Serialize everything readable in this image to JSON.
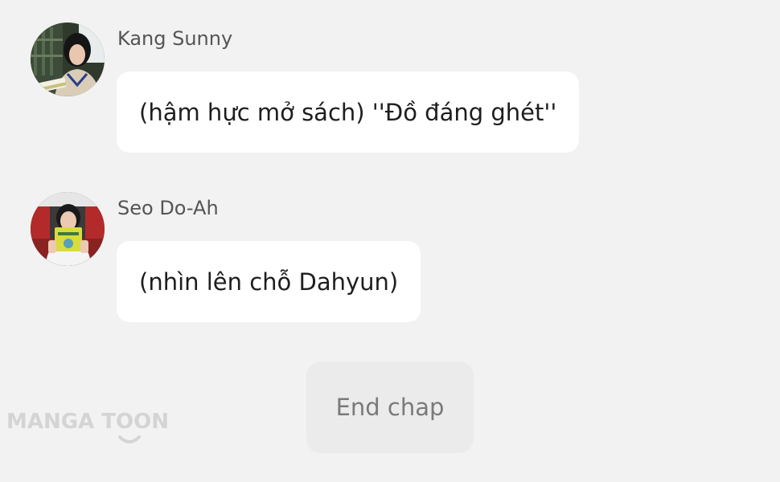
{
  "messages": [
    {
      "sender": "Kang Sunny",
      "text": "(hậm hực mở sách) ''Đồ đáng ghét''",
      "avatar": "avatar-kang-sunny"
    },
    {
      "sender": "Seo Do-Ah",
      "text": "(nhìn lên chỗ Dahyun)",
      "avatar": "avatar-seo-do-ah"
    }
  ],
  "end_button": {
    "label": "End chap"
  },
  "watermark": {
    "text": "MANGA TOON"
  },
  "colors": {
    "background": "#f2f2f2",
    "bubble": "#ffffff",
    "end_button": "#ebebeb",
    "watermark": "#d4d4d4"
  }
}
